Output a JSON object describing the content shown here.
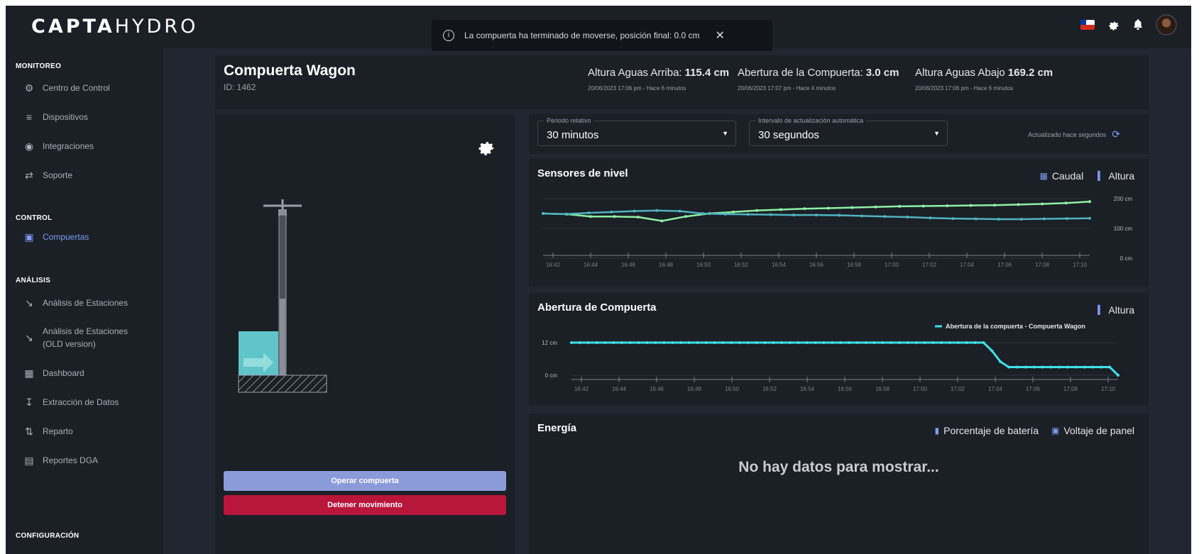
{
  "app": {
    "brand_bold": "CAPTA",
    "brand_light": "HYDRO"
  },
  "toast": {
    "icon": "info-icon",
    "message": "La compuerta ha terminado de moverse, posición final: 0.0 cm",
    "close": "✕"
  },
  "topbar_icons": [
    "chile-flag-icon",
    "gear-icon",
    "bell-icon",
    "user-avatar"
  ],
  "sidebar": {
    "sections": [
      {
        "title": "MONITOREO",
        "items": [
          {
            "label": "Centro de Control",
            "icon": "control-center-icon"
          },
          {
            "label": "Dispositivos",
            "icon": "list-icon"
          },
          {
            "label": "Integraciones",
            "icon": "integrations-icon"
          },
          {
            "label": "Soporte",
            "icon": "support-icon"
          }
        ]
      },
      {
        "title": "CONTROL",
        "items": [
          {
            "label": "Compuertas",
            "icon": "gate-icon",
            "active": true
          }
        ]
      },
      {
        "title": "ANÁLISIS",
        "items": [
          {
            "label": "Análisis de Estaciones",
            "icon": "line-chart-icon"
          },
          {
            "label": "Análisis de Estaciones",
            "label2": "(OLD version)",
            "icon": "line-chart-icon"
          },
          {
            "label": "Dashboard",
            "icon": "dashboard-icon"
          },
          {
            "label": "Extracción de Datos",
            "icon": "download-icon"
          },
          {
            "label": "Reparto",
            "icon": "distribution-icon"
          },
          {
            "label": "Reportes DGA",
            "icon": "report-icon"
          }
        ]
      },
      {
        "title": "CONFIGURACIÓN",
        "items": []
      }
    ]
  },
  "header": {
    "title": "Compuerta Wagon",
    "id": "ID: 1462",
    "stats": [
      {
        "label": "Altura Aguas Arriba:",
        "value": "115.4 cm",
        "date": "20/06/2023 17:06 pm - Hace 6 minutos"
      },
      {
        "label": "Abertura de la Compuerta:",
        "value": "3.0 cm",
        "date": "20/06/2023 17:07 pm - Hace 4 minutos"
      },
      {
        "label": "Altura Aguas Abajo",
        "value": "169.2 cm",
        "date": "20/06/2023 17:06 pm - Hace 6 minutos"
      }
    ]
  },
  "gate_panel": {
    "settings_icon": "gear-icon",
    "gate_opening_cm": 3.0,
    "operate_label": "Operar compuerta",
    "stop_label": "Detener movimiento"
  },
  "controls": {
    "period": {
      "label": "Periodo relativo",
      "value": "30 minutos"
    },
    "refresh": {
      "label": "Intervalo de actualización automática",
      "value": "30 segundos"
    },
    "updated": "Actualizado hace segundos"
  },
  "colors": {
    "accent": "#7d9cf3",
    "series_green": "#8ff0a4",
    "series_teal": "#4fb3bf",
    "series_cyan": "#3ee0e6",
    "stop": "#b8163a",
    "operate": "#8b9bd9"
  },
  "chart_data": [
    {
      "type": "line",
      "title": "Sensores de nivel",
      "legend": [
        {
          "label": "Caudal",
          "icon": "grid-icon"
        },
        {
          "label": "Altura",
          "icon": "bar-chart-icon"
        }
      ],
      "x": [
        "16:42",
        "16:44",
        "16:46",
        "16:48",
        "16:50",
        "16:52",
        "16:54",
        "16:56",
        "16:58",
        "17:00",
        "17:02",
        "17:04",
        "17:06",
        "17:08",
        "17:10"
      ],
      "yticks": [
        "200 cm",
        "100 cm",
        "0 cm"
      ],
      "ylim": [
        0,
        200
      ],
      "series": [
        {
          "color": "#8ff0a4",
          "values": [
            150,
            148,
            140,
            140,
            138,
            125,
            140,
            150,
            155,
            160,
            163,
            166,
            168,
            170,
            172,
            174,
            175,
            176,
            177,
            178,
            180,
            182,
            185,
            190
          ]
        },
        {
          "color": "#4fb3bf",
          "values": [
            150,
            148,
            152,
            155,
            158,
            160,
            158,
            150,
            148,
            147,
            146,
            145,
            145,
            144,
            142,
            140,
            138,
            135,
            133,
            132,
            131,
            131,
            132,
            133,
            134
          ]
        }
      ]
    },
    {
      "type": "line",
      "title": "Abertura de Compuerta",
      "legend": [
        {
          "label": "Altura",
          "icon": "bar-chart-icon"
        }
      ],
      "series_label": "Abertura de la compuerta - Compuerta Wagon",
      "x": [
        "16:42",
        "16:44",
        "16:46",
        "16:48",
        "16:50",
        "16:52",
        "16:54",
        "16:56",
        "16:58",
        "17:00",
        "17:02",
        "17:04",
        "17:06",
        "17:08",
        "17:10"
      ],
      "yticks": [
        "12 cm",
        "0 cm"
      ],
      "ylim": [
        0,
        12
      ],
      "series": [
        {
          "color": "#3ee0e6",
          "values": [
            12,
            12,
            12,
            12,
            12,
            12,
            12,
            12,
            12,
            12,
            12,
            12,
            12,
            12,
            12,
            12,
            12,
            12,
            12,
            12,
            12,
            12,
            12,
            12,
            12,
            12,
            12,
            12,
            12,
            12,
            12,
            12,
            12,
            12,
            12,
            12,
            12,
            12,
            12,
            12,
            12,
            12,
            12,
            12,
            12,
            12,
            12,
            12,
            12,
            12,
            9,
            5,
            3,
            3,
            3,
            3,
            3,
            3,
            3,
            3,
            3,
            3,
            3,
            3,
            3,
            0
          ]
        }
      ]
    }
  ],
  "energy": {
    "title": "Energía",
    "legend": [
      {
        "label": "Porcentaje de batería",
        "icon": "battery-icon"
      },
      {
        "label": "Voltaje de panel",
        "icon": "panel-icon"
      }
    ],
    "empty": "No hay datos para mostrar..."
  }
}
